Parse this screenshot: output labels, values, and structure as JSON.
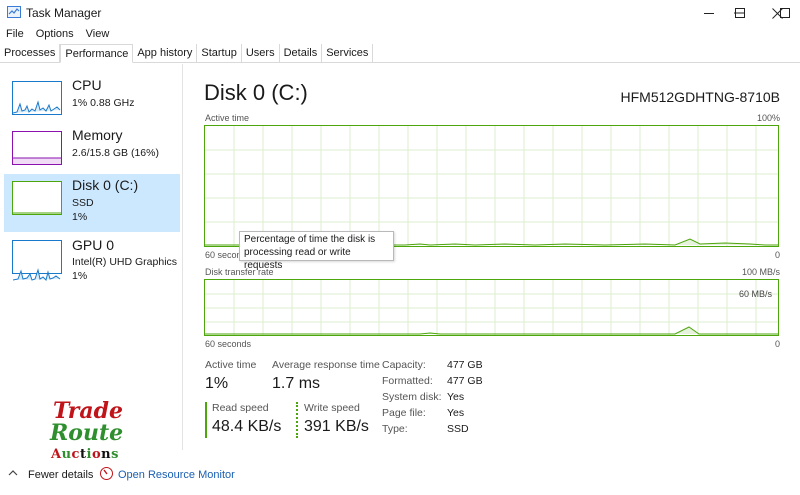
{
  "window": {
    "title": "Task Manager"
  },
  "menu": [
    "File",
    "Options",
    "View"
  ],
  "tabs": [
    "Processes",
    "Performance",
    "App history",
    "Startup",
    "Users",
    "Details",
    "Services"
  ],
  "active_tab": "Performance",
  "sidebar": {
    "items": [
      {
        "name": "CPU",
        "line1": "1% 0.88 GHz",
        "line2": "",
        "color": "#1979ca"
      },
      {
        "name": "Memory",
        "line1": "2.6/15.8 GB (16%)",
        "line2": "",
        "color": "#8b12ae"
      },
      {
        "name": "Disk 0 (C:)",
        "line1": "SSD",
        "line2": "1%",
        "color": "#4da60c"
      },
      {
        "name": "GPU 0",
        "line1": "Intel(R) UHD Graphics",
        "line2": "1%",
        "color": "#1979ca"
      }
    ]
  },
  "main": {
    "title": "Disk 0 (C:)",
    "model": "HFM512GDHTNG-8710B",
    "graph1": {
      "label": "Active time",
      "max": "100%",
      "left_axis": "60 secon",
      "min": "0"
    },
    "graph2": {
      "label": "Disk transfer rate",
      "max": "100 MB/s",
      "mid": "60 MB/s",
      "left_axis": "60 seconds",
      "min": "0"
    },
    "tooltip": "Percentage of time the disk is processing read or write requests",
    "stats": {
      "active_time_label": "Active time",
      "active_time_value": "1%",
      "avg_response_label": "Average response time",
      "avg_response_value": "1.7 ms",
      "read_speed_label": "Read speed",
      "read_speed_value": "48.4 KB/s",
      "write_speed_label": "Write speed",
      "write_speed_value": "391 KB/s"
    },
    "details": [
      {
        "key": "Capacity:",
        "value": "477 GB"
      },
      {
        "key": "Formatted:",
        "value": "477 GB"
      },
      {
        "key": "System disk:",
        "value": "Yes"
      },
      {
        "key": "Page file:",
        "value": "Yes"
      },
      {
        "key": "Type:",
        "value": "SSD"
      }
    ]
  },
  "logo": {
    "line1": "Trade",
    "line2": "Route",
    "line3": "Auctions"
  },
  "footer": {
    "fewer_details": "Fewer details",
    "open_resource_monitor": "Open Resource Monitor"
  },
  "colors": {
    "disk_green": "#4da60c",
    "selected_bg": "#cce8ff",
    "link_blue": "#1a5fb4"
  }
}
